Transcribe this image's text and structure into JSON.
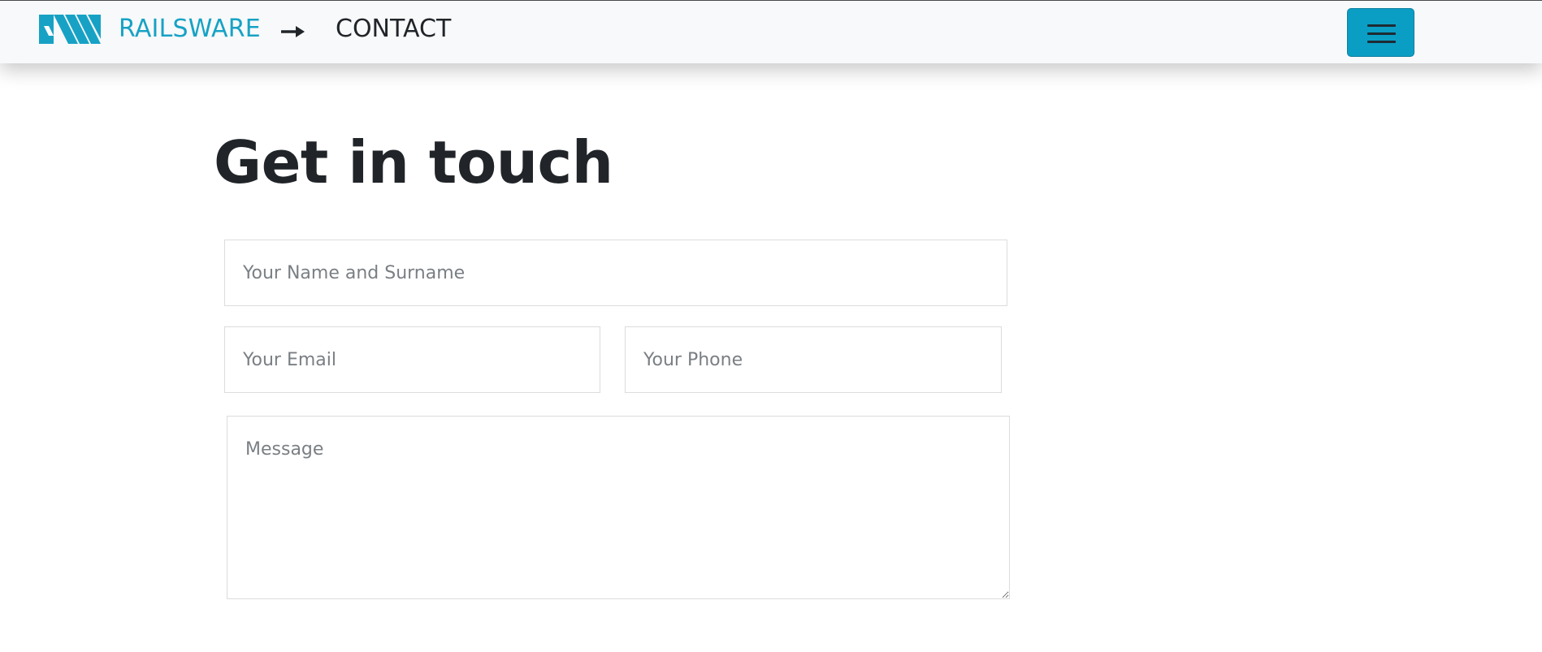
{
  "nav": {
    "brand_name": "RAILSWARE",
    "logo_icon": "railsware-logo-icon",
    "arrow_icon": "arrow-right-icon",
    "breadcrumb": "CONTACT",
    "menu_icon": "hamburger-menu-icon"
  },
  "page": {
    "title": "Get in touch"
  },
  "form": {
    "name_placeholder": "Your Name and Surname",
    "email_placeholder": "Your Email",
    "phone_placeholder": "Your Phone",
    "message_placeholder": "Message"
  },
  "colors": {
    "brand": "#17a2c5",
    "toggler_bg": "#0b9ec5",
    "navbar_bg": "#f8f9fa",
    "text": "#212529"
  }
}
